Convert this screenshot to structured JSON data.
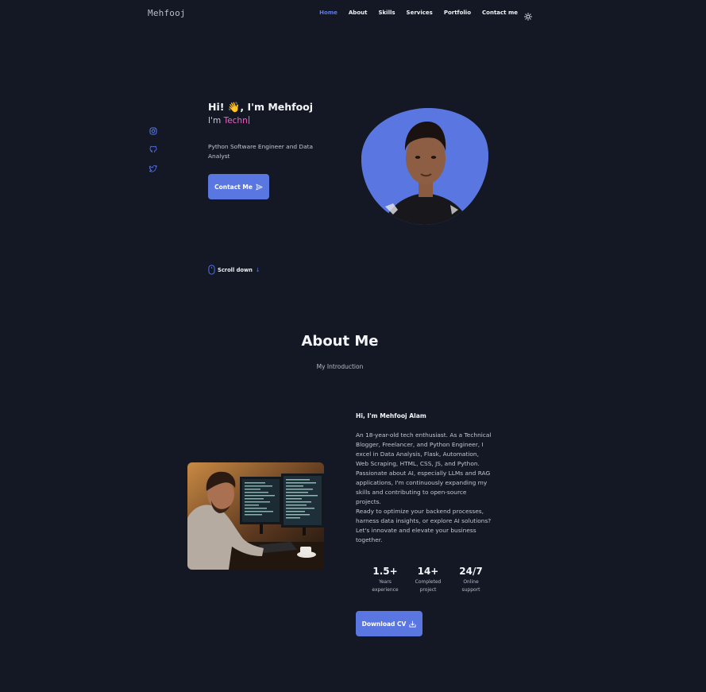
{
  "header": {
    "logo": "Mehfooj",
    "nav": [
      "Home",
      "About",
      "Skills",
      "Services",
      "Portfolio",
      "Contact me"
    ]
  },
  "hero": {
    "greeting": "Hi! 👋, I'm Mehfooj",
    "typed_prefix": "I'm ",
    "typed_text": "Techn",
    "description": "Python Software Engineer and Data Analyst",
    "contact_button": "Contact Me",
    "scroll_label": "Scroll down",
    "scroll_arrow": "↓"
  },
  "about": {
    "title": "About Me",
    "subtitle": "My Introduction",
    "heading": "Hi, I'm Mehfooj Alam",
    "paragraphs": [
      "An 18-year-old tech enthusiast. As a Technical Blogger, Freelancer, and Python Engineer, I excel in Data Analysis, Flask, Automation, Web Scraping, HTML, CSS, JS, and Python.",
      "Passionate about AI, especially LLMs and RAG applications, I'm continuously expanding my skills and contributing to open-source projects.",
      "Ready to optimize your backend processes, harness data insights, or explore AI solutions? Let's innovate and elevate your business together."
    ],
    "stats": [
      {
        "value": "1.5+",
        "label_1": "Years",
        "label_2": "experience"
      },
      {
        "value": "14+",
        "label_1": "Completed",
        "label_2": "project"
      },
      {
        "value": "24/7",
        "label_1": "Online",
        "label_2": "support"
      }
    ],
    "download_button": "Download CV"
  },
  "colors": {
    "background": "#141824",
    "accent": "#5a76e0",
    "highlight": "#ff59c7"
  },
  "icons": [
    "instagram-icon",
    "github-icon",
    "twitter-icon",
    "sun-icon",
    "send-icon",
    "mouse-icon",
    "download-icon"
  ]
}
